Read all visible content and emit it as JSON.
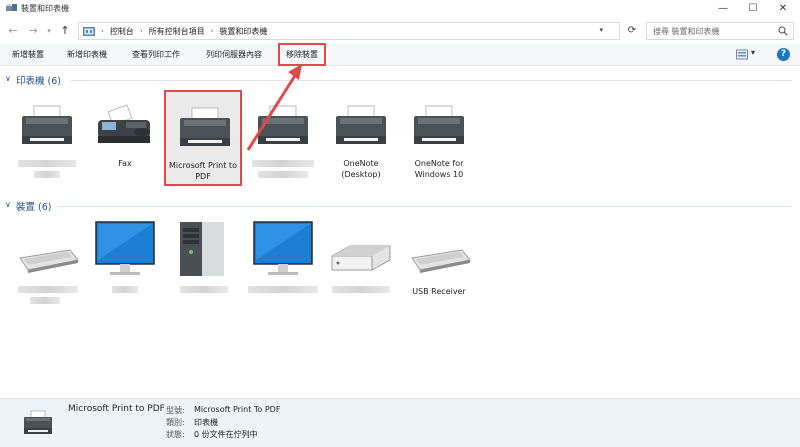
{
  "window": {
    "title": "裝置和印表機",
    "minimize": "—",
    "maximize": "☐",
    "close": "✕"
  },
  "nav": {
    "back": "←",
    "forward": "→",
    "history": "▾",
    "up": "↑"
  },
  "address": {
    "crumbs": [
      "控制台",
      "所有控制台項目",
      "裝置和印表機"
    ],
    "separator": "›",
    "dropdown": "▾",
    "refresh": "⟳"
  },
  "search": {
    "placeholder": "搜尋 裝置和印表機"
  },
  "commands": {
    "add_device": "新增裝置",
    "add_printer": "新增印表機",
    "see_print_queue": "查看列印工作",
    "print_server_properties": "列印伺服器內容",
    "remove_device": "移除裝置",
    "view_dropdown": "▾",
    "help": "?"
  },
  "groups": {
    "printers": {
      "label": "印表機 (6)",
      "chevron": "∨"
    },
    "devices": {
      "label": "裝置 (6)",
      "chevron": "∨"
    }
  },
  "printers": [
    {
      "label": ""
    },
    {
      "label": "Fax"
    },
    {
      "label": "Microsoft Print to PDF"
    },
    {
      "label": ""
    },
    {
      "label": "OneNote (Desktop)"
    },
    {
      "label": "OneNote for Windows 10"
    }
  ],
  "devices": [
    {
      "label": ""
    },
    {
      "label": ""
    },
    {
      "label": ""
    },
    {
      "label": ""
    },
    {
      "label": ""
    },
    {
      "label": "USB Receiver"
    }
  ],
  "details": {
    "name": "Microsoft Print to PDF",
    "model_key": "型號:",
    "model_value": "Microsoft Print To PDF",
    "category_key": "類別:",
    "category_value": "印表機",
    "status_key": "狀態:",
    "status_value": "0 份文件在佇列中"
  },
  "colors": {
    "accent": "#1f4e8c",
    "highlight": "#e04a4a",
    "help": "#1f74c4"
  }
}
